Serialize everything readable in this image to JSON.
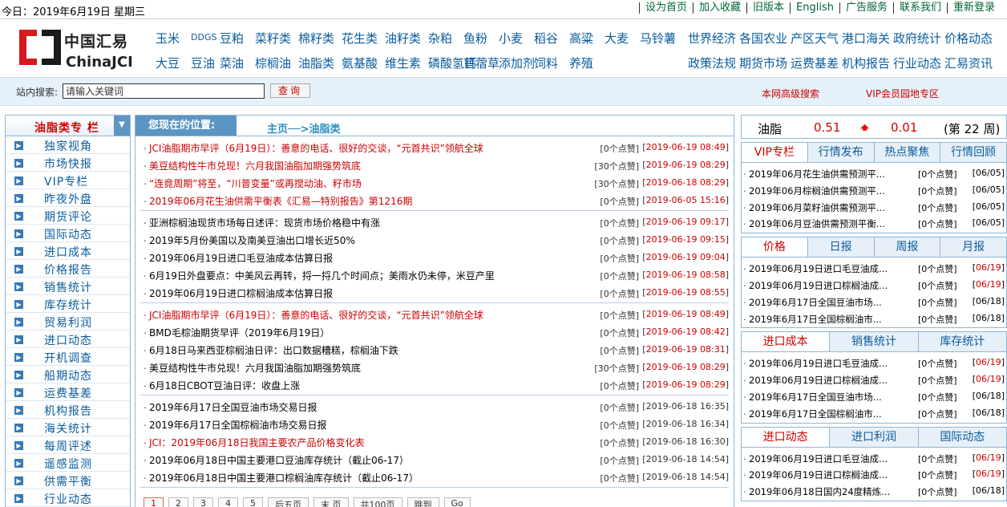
{
  "topbar": {
    "today": "今日：2019年6月19日 星期三",
    "links": [
      "设为首页",
      "加入收藏",
      "旧版本",
      "English",
      "广告服务",
      "联系我们",
      "重新登录"
    ]
  },
  "logo": {
    "cn": "中国汇易",
    "en": "ChinaJCI"
  },
  "nav_products": {
    "row1": [
      "玉米",
      "DDGS",
      "豆粕",
      "菜籽类",
      "棉籽类",
      "花生类",
      "油籽类",
      "杂粕",
      "鱼粉",
      "小麦",
      "稻谷",
      "高粱",
      "大麦",
      "马铃薯"
    ],
    "row2": [
      "大豆",
      "豆油",
      "菜油",
      "棕榈油",
      "油脂类",
      "氨基酸",
      "维生素",
      "磷酸氢钙",
      "苜蓿草",
      "添加剂",
      "饲料",
      "养殖"
    ]
  },
  "nav_topics": {
    "row1": [
      "世界经济",
      "各国农业",
      "产区天气",
      "港口海关",
      "政府统计",
      "价格动态"
    ],
    "row2": [
      "政策法规",
      "期货市场",
      "运费基差",
      "机构报告",
      "行业动态",
      "汇易资讯"
    ]
  },
  "search": {
    "label": "站内搜索:",
    "placeholder": "请输入关键词",
    "button": "查询",
    "advanced": "本网高级搜索",
    "vip": "VIP会员园地专区"
  },
  "sidebar": {
    "title": "油脂类专 栏",
    "items": [
      "独家视角",
      "市场快报",
      "VIP专栏",
      "昨夜外盘",
      "期货评论",
      "国际动态",
      "进口成本",
      "价格报告",
      "销售统计",
      "库存统计",
      "贸易利润",
      "进口动态",
      "开机调查",
      "船期动态",
      "运费基差",
      "机构报告",
      "海关统计",
      "每周评述",
      "遥感监测",
      "供需平衡",
      "行业动态"
    ]
  },
  "main": {
    "position_label": "您现在的位置:",
    "breadcrumb": "主页──>油脂类",
    "groups": [
      [
        {
          "title": "JCI油脂期市早评（6月19日）：善意的电话、很好的交谈，“元首共识”领航全球",
          "red": true,
          "likes": "[0个点赞]",
          "date": "2019-06-19 08:49"
        },
        {
          "title": "美豆结构性牛市兑现！六月我国油脂加期强势筑底",
          "red": true,
          "likes": "[30个点赞]",
          "date": "2019-06-19 08:29"
        },
        {
          "title": "“连竟周期”将至，“川普变量”或再搅动油、籽市场",
          "red": true,
          "likes": "[30个点赞]",
          "date": "2019-06-18 08:29"
        },
        {
          "title": "2019年06月花生油供需平衡表《汇易—特别报告》第1216期",
          "red": true,
          "likes": "[0个点赞]",
          "date": "2019-06-05 15:16"
        }
      ],
      [
        {
          "title": "亚洲棕榈油现货市场每日述评：现货市场价格稳中有涨",
          "red": false,
          "likes": "[0个点赞]",
          "date": "2019-06-19 09:17"
        },
        {
          "title": "2019年5月份美国以及南美豆油出口增长近50%",
          "red": false,
          "likes": "[0个点赞]",
          "date": "2019-06-19 09:15"
        },
        {
          "title": "2019年06月19日进口毛豆油成本估算日报",
          "red": false,
          "likes": "[0个点赞]",
          "date": "2019-06-19 09:04"
        },
        {
          "title": "6月19日外盘要点：中美风云再转，捋一捋几个时间点；美雨水仍未停，米豆产里",
          "red": false,
          "likes": "[0个点赞]",
          "date": "2019-06-19 08:58"
        },
        {
          "title": "2019年06月19日进口棕榈油成本估算日报",
          "red": false,
          "likes": "[0个点赞]",
          "date": "2019-06-19 08:55"
        }
      ],
      [
        {
          "title": "JCI油脂期市早评（6月19日）：善意的电话、很好的交谈，“元首共识”领航全球",
          "red": true,
          "likes": "[0个点赞]",
          "date": "2019-06-19 08:49"
        },
        {
          "title": "BMD毛棕油期货早评（2019年6月19日）",
          "red": false,
          "likes": "[0个点赞]",
          "date": "2019-06-19 08:42"
        },
        {
          "title": "6月18日马来西亚棕榈油日评：出口数据糟糕，棕榈油下跌",
          "red": false,
          "likes": "[0个点赞]",
          "date": "2019-06-19 08:31"
        },
        {
          "title": "美豆结构性牛市兑现！六月我国油脂加期强势筑底",
          "red": false,
          "likes": "[30个点赞]",
          "date": "2019-06-19 08:29"
        },
        {
          "title": "6月18日CBOT豆油日评：收盘上涨",
          "red": false,
          "likes": "[0个点赞]",
          "date": "2019-06-19 08:29"
        }
      ],
      [
        {
          "title": "2019年6月17日全国豆油市场交易日报",
          "red": false,
          "likes": "[0个点赞]",
          "date": "2019-06-18 16:35",
          "gray": true
        },
        {
          "title": "2019年6月17日全国棕榈油市场交易日报",
          "red": false,
          "likes": "[0个点赞]",
          "date": "2019-06-18 16:34",
          "gray": true
        },
        {
          "title": "JCI：2019年06月18日我国主要农产品价格变化表",
          "red": true,
          "likes": "[0个点赞]",
          "date": "2019-06-18 16:30",
          "gray": true
        },
        {
          "title": "2019年06月18日中国主要港口豆油库存统计（截止06-17）",
          "red": false,
          "likes": "[0个点赞]",
          "date": "2019-06-18 14:54",
          "gray": true
        },
        {
          "title": "2019年06月18日中国主要港口棕榈油库存统计（截止06-17）",
          "red": false,
          "likes": "[0个点赞]",
          "date": "2019-06-18 14:54",
          "gray": true
        }
      ]
    ],
    "pager": [
      "1",
      "2",
      "3",
      "4",
      "5",
      "后五页",
      "末 页",
      "共100页",
      "跳到",
      "Go"
    ]
  },
  "ticker": {
    "name": "油脂",
    "value": "0.51",
    "change": "0.01",
    "rank": "(第 22 周)",
    "colors": {
      "up": "#e00000"
    }
  },
  "boxes": [
    {
      "tabs": [
        "VIP专栏",
        "行情发布",
        "热点聚焦",
        "行情回顾"
      ],
      "active": 0,
      "items": [
        {
          "title": "2019年06月花生油供需预测平...",
          "likes": "[0个点赞]",
          "date": "06/05",
          "new": false
        },
        {
          "title": "2019年06月棕榈油供需预测平...",
          "likes": "[0个点赞]",
          "date": "06/05",
          "new": false
        },
        {
          "title": "2019年06月菜籽油供需预测平...",
          "likes": "[0个点赞]",
          "date": "06/05",
          "new": false
        },
        {
          "title": "2019年06月豆油供需预测平衡...",
          "likes": "[0个点赞]",
          "date": "06/05",
          "new": false
        }
      ]
    },
    {
      "tabs": [
        "价格",
        "日报",
        "周报",
        "月报"
      ],
      "active": 0,
      "items": [
        {
          "title": "2019年06月19日进口毛豆油成...",
          "likes": "[0个点赞]",
          "date": "06/19",
          "new": true
        },
        {
          "title": "2019年06月19日进口棕榈油成...",
          "likes": "[0个点赞]",
          "date": "06/19",
          "new": true
        },
        {
          "title": "2019年6月17日全国豆油市场...",
          "likes": "[0个点赞]",
          "date": "06/18",
          "new": false
        },
        {
          "title": "2019年6月17日全国棕榈油市...",
          "likes": "[0个点赞]",
          "date": "06/18",
          "new": false
        }
      ]
    },
    {
      "tabs": [
        "进口成本",
        "销售统计",
        "库存统计"
      ],
      "active": 0,
      "items": [
        {
          "title": "2019年06月19日进口毛豆油成...",
          "likes": "[0个点赞]",
          "date": "06/19",
          "new": true
        },
        {
          "title": "2019年06月19日进口棕榈油成...",
          "likes": "[0个点赞]",
          "date": "06/19",
          "new": true
        },
        {
          "title": "2019年6月17日全国豆油市场...",
          "likes": "[0个点赞]",
          "date": "06/18",
          "new": false
        },
        {
          "title": "2019年6月17日全国棕榈油市...",
          "likes": "[0个点赞]",
          "date": "06/18",
          "new": false
        }
      ]
    },
    {
      "tabs": [
        "进口动态",
        "进口利润",
        "国际动态"
      ],
      "active": 0,
      "items": [
        {
          "title": "2019年06月19日进口毛豆油成...",
          "likes": "[0个点赞]",
          "date": "06/19",
          "new": true
        },
        {
          "title": "2019年06月19日进口棕榈油成...",
          "likes": "[0个点赞]",
          "date": "06/19",
          "new": true
        },
        {
          "title": "2019年06月18日国内24度精炼...",
          "likes": "[0个点赞]",
          "date": "06/18",
          "new": false
        }
      ]
    }
  ]
}
